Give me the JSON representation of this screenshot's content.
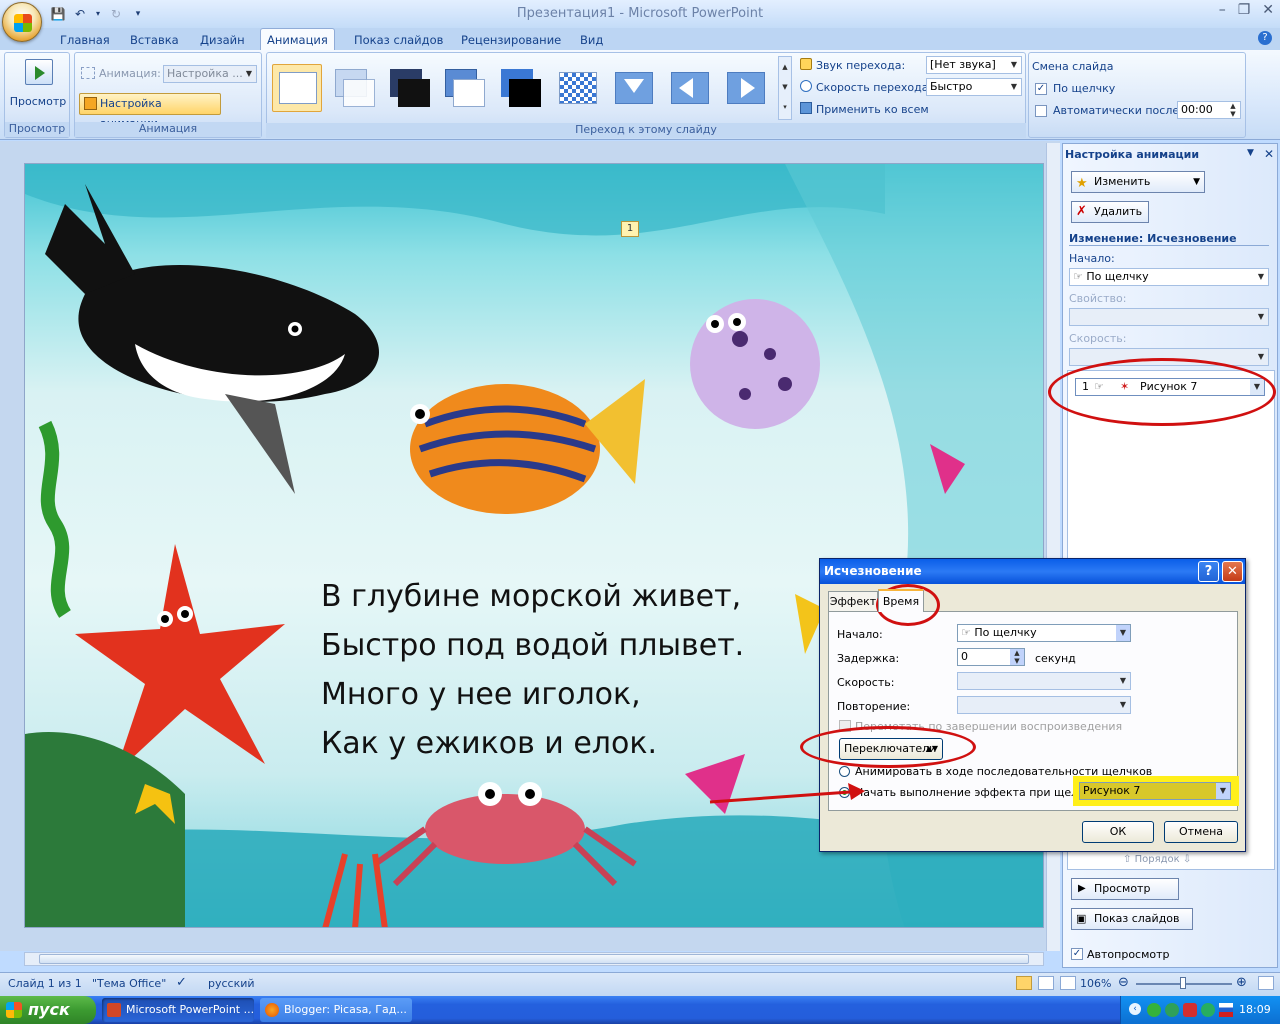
{
  "window": {
    "title": "Презентация1 - Microsoft PowerPoint"
  },
  "tabs": [
    {
      "label": "Главная"
    },
    {
      "label": "Вставка"
    },
    {
      "label": "Дизайн"
    },
    {
      "label": "Анимация"
    },
    {
      "label": "Показ слайдов"
    },
    {
      "label": "Рецензирование"
    },
    {
      "label": "Вид"
    }
  ],
  "ribbon": {
    "preview": {
      "label": "Просмотр",
      "group": "Просмотр"
    },
    "animation": {
      "anim_label": "Анимация:",
      "anim_value": "Настройка ...",
      "custom_button": "Настройка анимации",
      "group": "Анимация"
    },
    "transition": {
      "sound_label": "Звук перехода:",
      "sound_value": "[Нет звука]",
      "speed_label": "Скорость перехода:",
      "speed_value": "Быстро",
      "apply_all": "Применить ко всем",
      "group": "Переход к этому слайду"
    },
    "advance": {
      "title": "Смена слайда",
      "on_click": "По щелчку",
      "on_click_checked": true,
      "auto_after": "Автоматически после:",
      "auto_checked": false,
      "auto_time": "00:00"
    }
  },
  "slide": {
    "marker": "1",
    "poem": [
      "В глубине морской живет,",
      "Быстро под водой плывет.",
      "Много у нее иголок,",
      "Как у ежиков и елок."
    ]
  },
  "pane": {
    "title": "Настройка анимации",
    "change_btn": "Изменить",
    "delete_btn": "Удалить",
    "effect_heading": "Изменение: Исчезновение",
    "start_label": "Начало:",
    "start_value": "По щелчку",
    "property_label": "Свойство:",
    "speed_label": "Скорость:",
    "list_item": {
      "index": "1",
      "name": "Рисунок 7"
    },
    "order_label": "Порядок",
    "play_btn": "Просмотр",
    "slideshow_btn": "Показ слайдов",
    "autopreview": "Автопросмотр"
  },
  "dialog": {
    "title": "Исчезновение",
    "tab_effect": "Эффект",
    "tab_timing": "Время",
    "start_label": "Начало:",
    "start_value": "По щелчку",
    "delay_label": "Задержка:",
    "delay_value": "0",
    "delay_unit": "секунд",
    "speed_label": "Скорость:",
    "repeat_label": "Повторение:",
    "rewind_label": "Перемотать по завершении воспроизведения",
    "triggers_btn": "Переключатели",
    "radio1": "Анимировать в ходе последовательности щелчков",
    "radio2": "Начать выполнение эффекта при щелчке",
    "trigger_value": "Рисунок 7",
    "ok": "ОК",
    "cancel": "Отмена"
  },
  "status": {
    "slide": "Слайд 1 из 1",
    "theme": "\"Тема Office\"",
    "lang": "русский",
    "zoom": "106%"
  },
  "taskbar": {
    "start": "пуск",
    "items": [
      "Microsoft PowerPoint ...",
      "Blogger: Picasa, Гад..."
    ],
    "clock": "18:09"
  },
  "colors": {
    "highlight": "#ffef1a",
    "annotation": "#d01010",
    "ribbon": "#dbe8f9"
  }
}
